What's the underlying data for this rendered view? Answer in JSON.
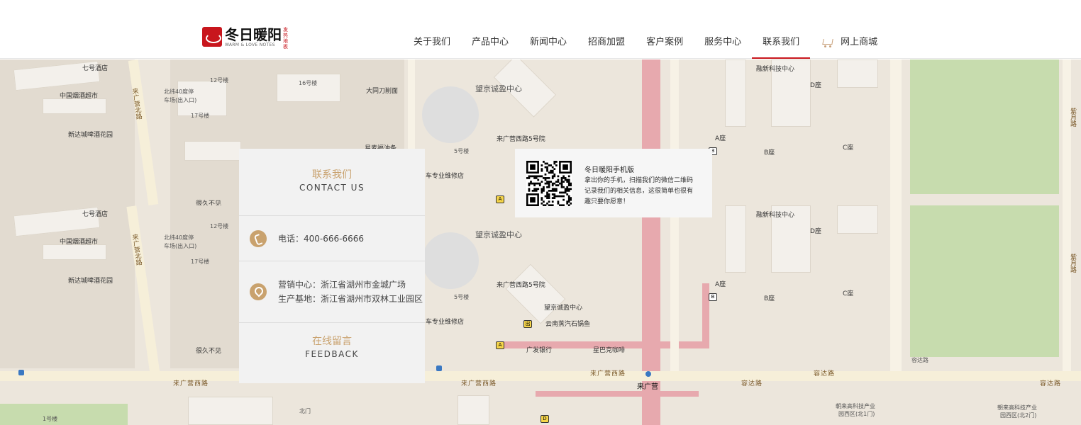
{
  "header": {
    "logo": {
      "cn": "冬日暖阳",
      "en": "WARM & LOVE NOTES",
      "tag": "发热地板"
    },
    "nav": [
      {
        "label": "关于我们"
      },
      {
        "label": "产品中心"
      },
      {
        "label": "新闻中心"
      },
      {
        "label": "招商加盟"
      },
      {
        "label": "客户案例"
      },
      {
        "label": "服务中心"
      },
      {
        "label": "联系我们",
        "active": true
      },
      {
        "label": "网上商城",
        "icon": "cart-icon"
      }
    ],
    "accent_color": "#c8161d"
  },
  "contact": {
    "title_cn": "联系我们",
    "title_en": "CONTACT US",
    "phone": "电话：400-666-6666",
    "sales_center": "营销中心：浙江省湖州市金城广场",
    "production_base": "生产基地：浙江省湖州市双林工业园区",
    "feedback_cn": "在线留言",
    "feedback_en": "FEEDBACK",
    "accent_color": "#c9a26e"
  },
  "mobile": {
    "title": "冬日暖阳手机版",
    "desc_1": "拿出你的手机，扫描我们的微信二维码",
    "desc_2": "记录我们的相关信息，这很简单也很有",
    "desc_3": "趣只要你愿意！"
  },
  "map": {
    "labels_top": {
      "l1": "七号酒店",
      "l2": "中国烟酒超市",
      "l3": "北纬40度停",
      "l4": "车场(出入口)",
      "l5": "17号楼",
      "l6": "新达城啤酒花园",
      "l7": "12号楼",
      "l8": "16号楼",
      "l9": "大同刀削面",
      "l10": "望京诚盈中心",
      "l11": "来广营西路5号院",
      "l12": "5号楼",
      "l13": "融新科技中心",
      "l14": "D座",
      "l15": "A座",
      "l16": "B座",
      "l17": "C座",
      "l18": "紫月路",
      "l19": "来广营北路",
      "l20": "很久不见",
      "l21": "车专业维修店",
      "l22": "易麦福油条"
    },
    "labels_bottom": {
      "l1": "七号酒店",
      "l2": "中国烟酒超市",
      "l3": "北纬40度停",
      "l4": "车场(出入口)",
      "l5": "17号楼",
      "l6": "新达城啤酒花园",
      "l7": "12号楼",
      "l8": "望京诚盈中心",
      "l9": "来广营西路5号院",
      "l10": "5号楼",
      "l11": "车专业维修店",
      "l12": "望京诚盈中心",
      "l13": "云南蒸汽石锅鱼",
      "l14": "广发银行",
      "l15": "星巴克咖啡",
      "l16": "很久不见",
      "l17": "来广营西路",
      "l18": "来广营西路",
      "l19": "来广营西路",
      "l20": "来广营",
      "l21": "容达路",
      "l22": "容达路",
      "l23": "容达路",
      "l24": "容达路",
      "l25": "北门",
      "l26": "1号楼",
      "l27": "朝来高科技产业",
      "l28": "园西区(北1门)",
      "l29": "朝来高科技产业",
      "l30": "园西区(北2门)",
      "l31": "融新科技中心",
      "l32": "D座",
      "l33": "A座",
      "l34": "B座",
      "l35": "C座",
      "l36": "紫月路",
      "l37": "来广营北路"
    }
  }
}
